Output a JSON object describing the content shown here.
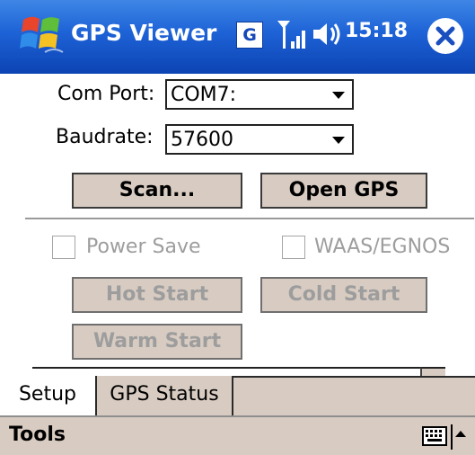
{
  "titlebar": {
    "app_title": "GPS Viewer",
    "g_badge": "G",
    "clock": "15:18",
    "icons": [
      "windows-start-icon",
      "g-badge-icon",
      "signal-icon",
      "volume-icon",
      "close-icon"
    ]
  },
  "setup": {
    "com_port_label": "Com Port:",
    "com_port_value": "COM7:",
    "baudrate_label": "Baudrate:",
    "baudrate_value": "57600",
    "scan_button": "Scan...",
    "open_gps_button": "Open GPS",
    "power_save_label": "Power Save",
    "waas_label": "WAAS/EGNOS",
    "hot_start_button": "Hot Start",
    "cold_start_button": "Cold Start",
    "warm_start_button": "Warm Start"
  },
  "tabs": [
    {
      "label": "Setup",
      "active": true
    },
    {
      "label": "GPS Status",
      "active": false
    }
  ],
  "menubar": {
    "tools_label": "Tools",
    "icons": [
      "keyboard-icon",
      "sip-up-arrow-icon"
    ]
  },
  "colors": {
    "titlebar_blue": "#1d62d6",
    "panel_beige": "#d8ccc2",
    "disabled_text": "#9d9d9d"
  }
}
